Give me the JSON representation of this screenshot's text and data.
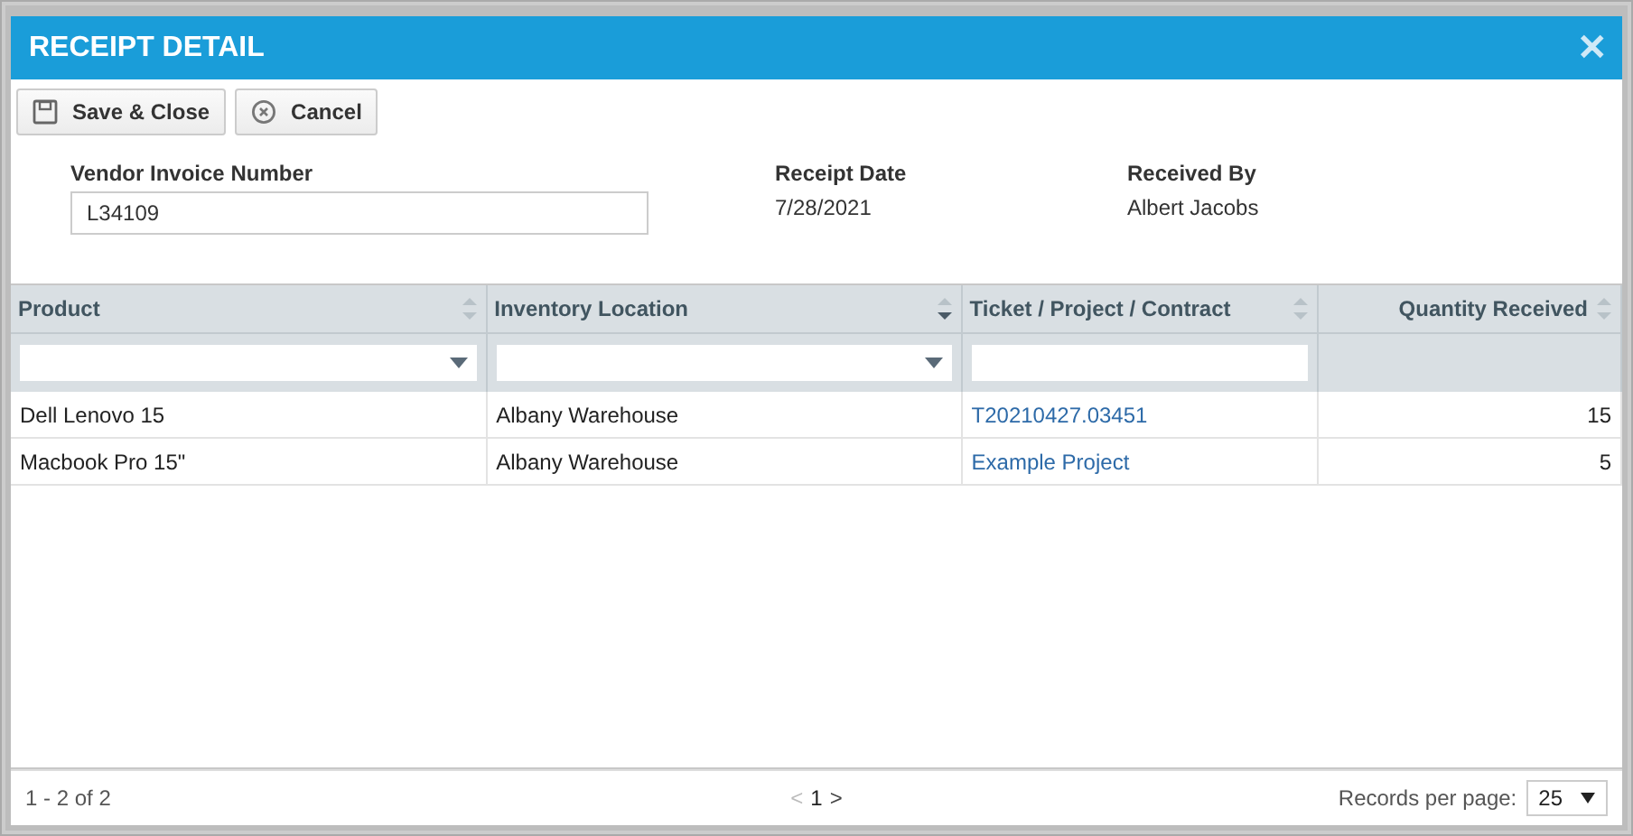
{
  "window": {
    "title": "RECEIPT DETAIL",
    "close": "✕"
  },
  "toolbar": [
    {
      "label": "Save & Close",
      "kind": "save"
    },
    {
      "label": "Cancel",
      "kind": "cancel"
    }
  ],
  "form": {
    "vendor_invoice": {
      "label": "Vendor Invoice Number",
      "value": "L34109"
    },
    "receipt_date": {
      "label": "Receipt Date",
      "value": "7/28/2021"
    },
    "received_by": {
      "label": "Received By",
      "value": "Albert Jacobs"
    }
  },
  "table": {
    "columns": [
      {
        "label": "Product",
        "sorted_descending": false,
        "filter": {
          "kind": "dropdown"
        },
        "right_aligned": false
      },
      {
        "label": "Inventory Location",
        "sorted_descending": true,
        "filter": {
          "kind": "dropdown"
        },
        "right_aligned": false
      },
      {
        "label": "Ticket / Project / Contract",
        "sorted_descending": false,
        "filter": {
          "kind": "text"
        },
        "right_aligned": false
      },
      {
        "label": "Quantity Received",
        "sorted_descending": false,
        "right_aligned": true
      }
    ],
    "rows": [
      {
        "cells": [
          {
            "text": "Dell Lenovo 15",
            "link": false
          },
          {
            "text": "Albany Warehouse",
            "link": false
          },
          {
            "text": "T20210427.03451",
            "link": true
          },
          {
            "text": "15",
            "link": false
          }
        ]
      },
      {
        "cells": [
          {
            "text": "Macbook Pro 15\"",
            "link": false
          },
          {
            "text": "Albany Warehouse",
            "link": false
          },
          {
            "text": "Example Project",
            "link": true
          },
          {
            "text": "5",
            "link": false
          }
        ]
      }
    ]
  },
  "footer": {
    "range": "1 - 2 of 2",
    "pager": {
      "prev": "<",
      "page": "1",
      "next": ">",
      "prev_disabled": true,
      "next_disabled": false
    },
    "records_label": "Records per page:",
    "records_value": "25"
  }
}
